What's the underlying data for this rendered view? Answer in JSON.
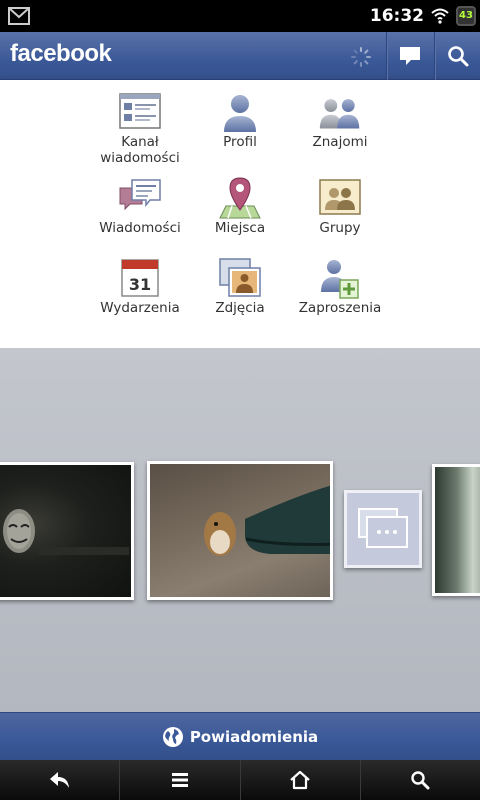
{
  "status_bar": {
    "time": "16:32",
    "battery_level": "43",
    "icons": [
      "gmail-icon",
      "wifi-icon",
      "battery-icon"
    ]
  },
  "header": {
    "app_title": "facebook",
    "loading": true
  },
  "menu": {
    "items": [
      {
        "label": "Kanał\nwiadomości",
        "icon": "news-feed-icon"
      },
      {
        "label": "Profil",
        "icon": "profile-icon"
      },
      {
        "label": "Znajomi",
        "icon": "friends-icon"
      },
      {
        "label": "Wiadomości",
        "icon": "messages-icon"
      },
      {
        "label": "Miejsca",
        "icon": "places-icon"
      },
      {
        "label": "Grupy",
        "icon": "groups-icon"
      },
      {
        "label": "Wydarzenia",
        "icon": "events-icon"
      },
      {
        "label": "Zdjęcia",
        "icon": "photos-icon"
      },
      {
        "label": "Zaproszenia",
        "icon": "requests-icon"
      }
    ],
    "calendar_day": "31"
  },
  "notifications_bar": {
    "label": "Powiadomienia"
  },
  "colors": {
    "brand": "#3b5998",
    "panel": "#ffffff",
    "background": "#b9bcc3"
  }
}
